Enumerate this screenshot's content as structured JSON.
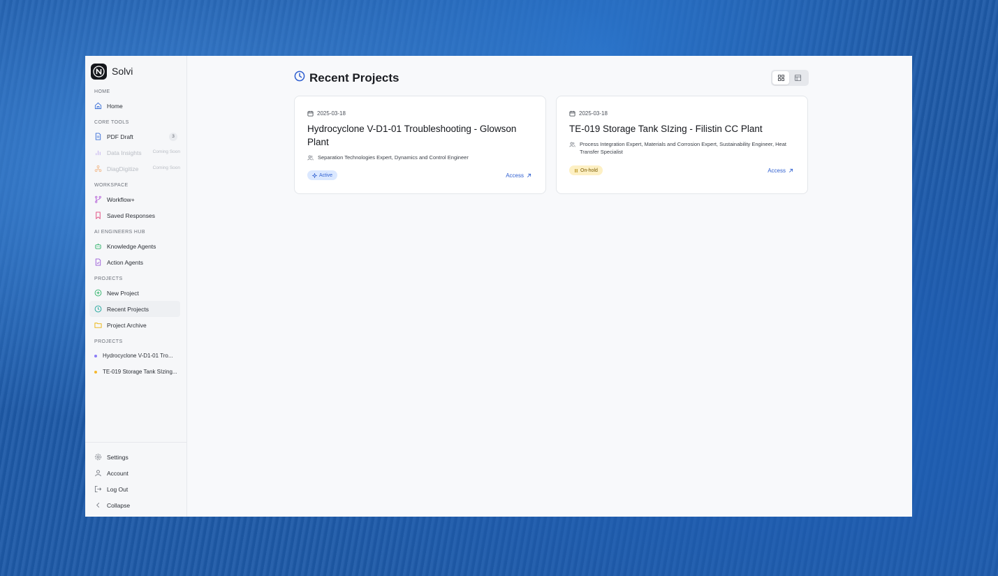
{
  "app": {
    "name": "Solvi"
  },
  "sidebar": {
    "sections": {
      "home": "HOME",
      "core_tools": "CORE TOOLS",
      "workspace": "WORKSPACE",
      "ai_hub": "AI ENGINEERS HUB",
      "projects": "PROJECTS",
      "projects_list": "PROJECTS"
    },
    "items": {
      "home": "Home",
      "pdf_draft": "PDF Draft",
      "pdf_draft_badge": "3",
      "data_insights": "Data Insights",
      "data_insights_note": "Coming Soon",
      "diagdigitize": "DiagDigitize",
      "diagdigitize_note": "Coming Soon",
      "workflow": "Workflow+",
      "saved_responses": "Saved Responses",
      "knowledge_agents": "Knowledge Agents",
      "action_agents": "Action Agents",
      "new_project": "New Project",
      "recent_projects": "Recent Projects",
      "project_archive": "Project Archive"
    },
    "project_links": [
      {
        "label": "Hydrocyclone V-D1-01 Tro...",
        "dot_color": "#8b7cf6"
      },
      {
        "label": "TE-019 Storage Tank SIzing...",
        "dot_color": "#f5b82e"
      }
    ],
    "bottom": {
      "settings": "Settings",
      "account": "Account",
      "logout": "Log Out",
      "collapse": "Collapse"
    }
  },
  "main": {
    "title": "Recent Projects",
    "accent_color": "#2f5fd0",
    "cards": [
      {
        "date": "2025-03-18",
        "title": "Hydrocyclone V-D1-01 Troubleshooting - Glowson Plant",
        "experts": "Separation Technologies Expert, Dynamics and Control Engineer",
        "status": "Active",
        "status_color": "#dbe8ff",
        "access": "Access"
      },
      {
        "date": "2025-03-18",
        "title": "TE-019 Storage Tank SIzing - Filistin CC Plant",
        "experts": "Process Integration Expert, Materials and Corrosion Expert, Sustainability Engineer, Heat Transfer Specialist",
        "status": "On-hold",
        "status_color": "#fdf0c4",
        "access": "Access"
      }
    ]
  }
}
